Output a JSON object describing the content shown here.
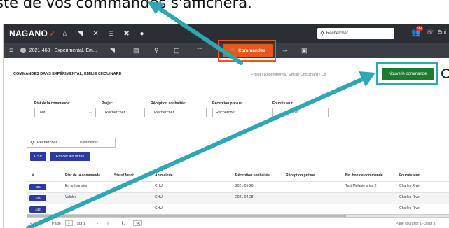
{
  "caption": {
    "text": "ste de vos commandes s'affichera."
  },
  "topbar": {
    "logo": "NAGANO",
    "search_placeholder": "Rechercher",
    "notif_count": "99",
    "user_label": "Émi"
  },
  "secbar": {
    "project": "2021-468 - Expérimental, Em...",
    "commandes_label": "Commandes"
  },
  "page": {
    "title": "COMMANDES DANS EXPÉRIMENTAL, EMILIE CHOUINARD",
    "breadcrumb": "Projet  /  Expérimental, Emilie Chouinard  /  Co",
    "new_order_label": "Nouvelle commande"
  },
  "filters": {
    "etat_label": "État de la commande:",
    "etat_value": "Tout",
    "projet_label": "Projet:",
    "projet_placeholder": "Rechercher",
    "reception_souhaitee_label": "Réception souhaitée:",
    "reception_souhaitee_placeholder": "Rechercher",
    "reception_prevue_label": "Réception prévue:",
    "reception_prevue_placeholder": "Rechercher",
    "fournisseur_label": "Fournisseur:",
    "fournisseur_placeholder": "cher"
  },
  "search": {
    "placeholder": "Rechercher",
    "params_label": "Paramètres"
  },
  "buttons": {
    "csv": "CSV",
    "clear_filters": "Effacer les filtres"
  },
  "table": {
    "headers": [
      "#",
      "État de la commande",
      "Statut fonct...",
      "Animalerie",
      "Réception souhaitée",
      "Réception prévue",
      "No. bon de commande",
      "Fournisseur"
    ],
    "rows": [
      {
        "id": "485",
        "etat": "En préparation",
        "statut": "",
        "animalerie": "CHU",
        "souhaitee": "2021-05-26",
        "prevue": "",
        "bon": "Test Mélanie prise 3",
        "fournisseur": "Charles River"
      },
      {
        "id": "445",
        "etat": "Validée",
        "statut": "",
        "animalerie": "CHU",
        "souhaitee": "2021-04-28",
        "prevue": "",
        "bon": "",
        "fournisseur": "Charles River"
      },
      {
        "id": "442",
        "etat": "",
        "statut": "",
        "animalerie": "CHU",
        "souhaitee": "",
        "prevue": "",
        "bon": "",
        "fournisseur": "Charles River"
      }
    ]
  },
  "pager": {
    "page_label": "Page",
    "page_value": "1",
    "of_label": "sur 1",
    "page_size": "15",
    "page_count": "Page courante 1 - 3 sur 3"
  },
  "colors": {
    "accent_orange": "#e8561d",
    "green": "#1e7a2f",
    "blue": "#2a3a9e",
    "arrow_teal": "#2ea7b5"
  }
}
